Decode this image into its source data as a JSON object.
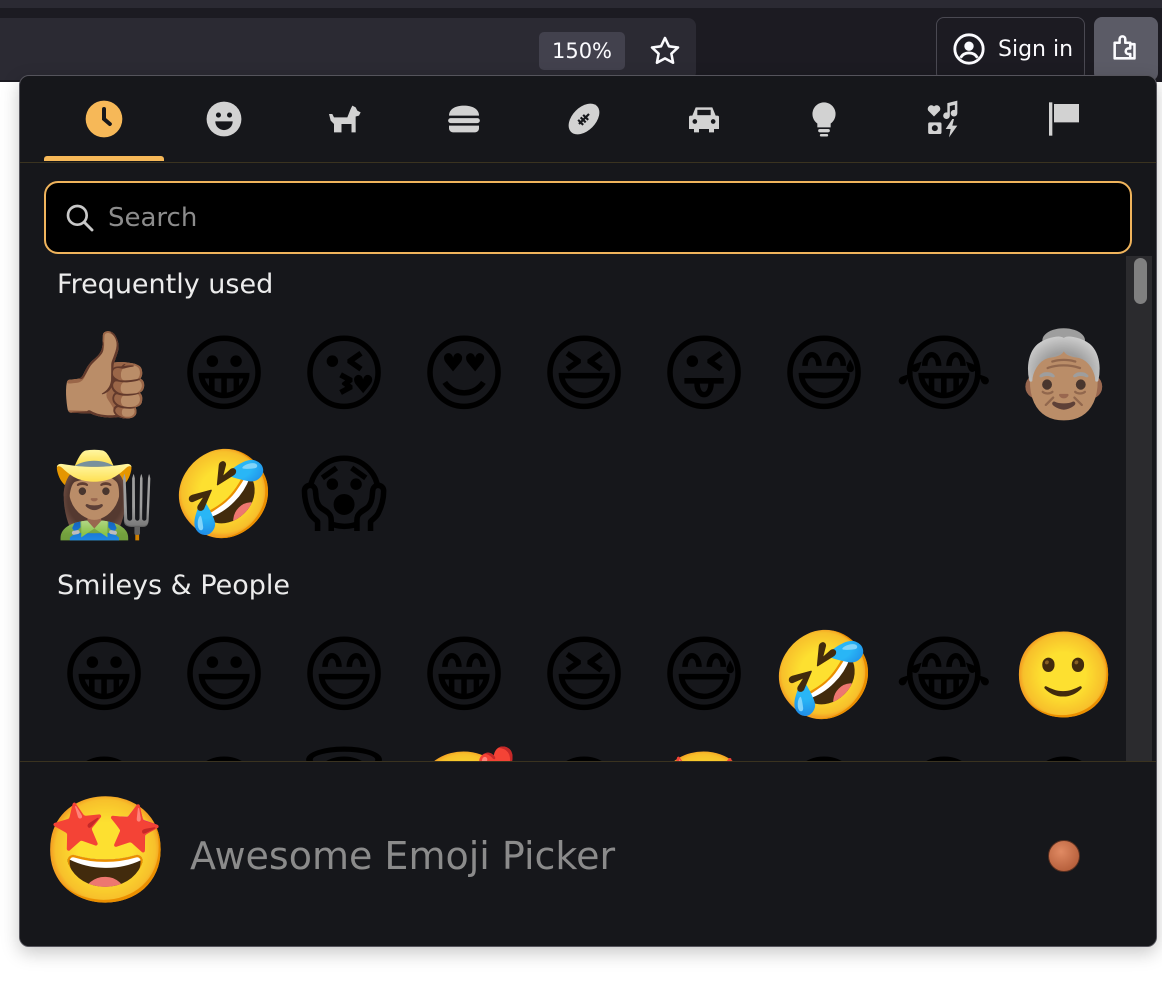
{
  "browser": {
    "zoom_label": "150%",
    "signin_label": "Sign in",
    "icons": [
      "star-icon",
      "account-icon",
      "extension-icon"
    ]
  },
  "picker": {
    "accent_color": "#f6b858",
    "tabs": [
      {
        "name": "recent",
        "icon": "clock-icon",
        "active": true
      },
      {
        "name": "smileys",
        "icon": "smiley-icon"
      },
      {
        "name": "animals",
        "icon": "dog-icon"
      },
      {
        "name": "food",
        "icon": "burger-icon"
      },
      {
        "name": "activities",
        "icon": "football-icon"
      },
      {
        "name": "travel",
        "icon": "car-icon"
      },
      {
        "name": "objects",
        "icon": "lightbulb-icon"
      },
      {
        "name": "symbols",
        "icon": "symbols-icon"
      },
      {
        "name": "flags",
        "icon": "flag-icon"
      }
    ],
    "search": {
      "placeholder": "Search",
      "value": ""
    },
    "sections": [
      {
        "title": "Frequently used",
        "emojis": [
          "👍🏽",
          "😀",
          "😘",
          "😍",
          "😆",
          "😜",
          "😅",
          "😂",
          "👵🏽",
          "👩🏽‍🌾",
          "🤣",
          "😱"
        ]
      },
      {
        "title": "Smileys & People",
        "emojis": [
          "😀",
          "😃",
          "😄",
          "😁",
          "😆",
          "😅",
          "🤣",
          "😂",
          "🙂",
          "😉",
          "😊",
          "😇",
          "🥰",
          "😍",
          "🤩",
          "😘",
          "😗",
          "😚"
        ]
      }
    ],
    "footer": {
      "emoji": "🤩",
      "title": "Awesome Emoji Picker",
      "skin_tone_color": "#c0643c"
    }
  }
}
